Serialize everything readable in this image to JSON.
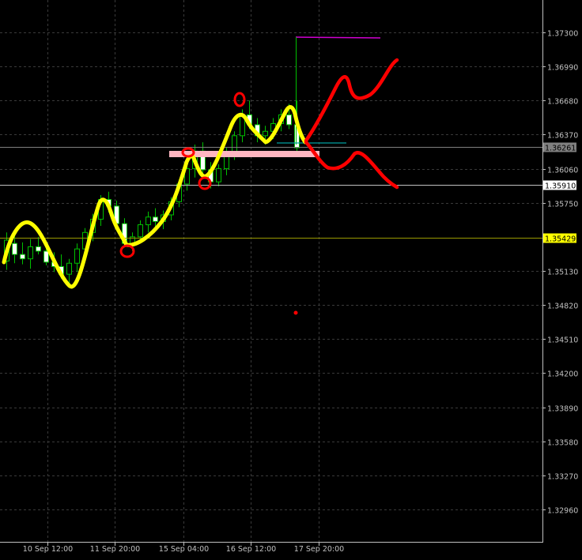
{
  "chart_data": {
    "type": "candlestick",
    "title": "",
    "xlabel": "",
    "ylabel": "",
    "grid": true,
    "ylim": [
      1.3265,
      1.3755
    ],
    "x_tick_labels": [
      "10 Sep 12:00",
      "11 Sep 20:00",
      "15 Sep 04:00",
      "16 Sep 12:00",
      "17 Sep 20:00"
    ],
    "y_tick_labels": [
      "1.37300",
      "1.36990",
      "1.36680",
      "1.36370",
      "1.36060",
      "1.35750",
      "1.35130",
      "1.34820",
      "1.34510",
      "1.34200",
      "1.33890",
      "1.33580",
      "1.33270",
      "1.32960"
    ],
    "y_ticks": [
      1.373,
      1.3699,
      1.3668,
      1.3637,
      1.3606,
      1.3575,
      1.3513,
      1.3482,
      1.3451,
      1.342,
      1.3389,
      1.3358,
      1.3327,
      1.3296
    ],
    "price_labels": [
      {
        "value": 1.36261,
        "text": "1.36261",
        "bg": "#808080",
        "fg": "#000000",
        "line": "#808080"
      },
      {
        "value": 1.3591,
        "text": "1.35910",
        "bg": "#ffffff",
        "fg": "#000000",
        "line": "#c0c0c0"
      },
      {
        "value": 1.35429,
        "text": "1.35429",
        "bg": "#ffff00",
        "fg": "#000000",
        "line": "#9a9a00"
      }
    ],
    "candles": [
      {
        "o": 1.3522,
        "h": 1.3548,
        "l": 1.3514,
        "c": 1.3541
      },
      {
        "o": 1.3538,
        "h": 1.3546,
        "l": 1.352,
        "c": 1.3528
      },
      {
        "o": 1.3528,
        "h": 1.3539,
        "l": 1.3519,
        "c": 1.3524
      },
      {
        "o": 1.3524,
        "h": 1.3542,
        "l": 1.3515,
        "c": 1.3535
      },
      {
        "o": 1.3535,
        "h": 1.3544,
        "l": 1.3528,
        "c": 1.3531
      },
      {
        "o": 1.3531,
        "h": 1.3538,
        "l": 1.3518,
        "c": 1.3521
      },
      {
        "o": 1.3521,
        "h": 1.353,
        "l": 1.3512,
        "c": 1.3517
      },
      {
        "o": 1.3517,
        "h": 1.3528,
        "l": 1.3506,
        "c": 1.351
      },
      {
        "o": 1.351,
        "h": 1.3524,
        "l": 1.3498,
        "c": 1.352
      },
      {
        "o": 1.352,
        "h": 1.3538,
        "l": 1.3512,
        "c": 1.3533
      },
      {
        "o": 1.3533,
        "h": 1.3552,
        "l": 1.3528,
        "c": 1.3548
      },
      {
        "o": 1.3548,
        "h": 1.3565,
        "l": 1.354,
        "c": 1.356
      },
      {
        "o": 1.356,
        "h": 1.3582,
        "l": 1.3554,
        "c": 1.3578
      },
      {
        "o": 1.3578,
        "h": 1.3585,
        "l": 1.3566,
        "c": 1.3572
      },
      {
        "o": 1.3572,
        "h": 1.3577,
        "l": 1.3552,
        "c": 1.3556
      },
      {
        "o": 1.3556,
        "h": 1.3561,
        "l": 1.3535,
        "c": 1.3538
      },
      {
        "o": 1.3538,
        "h": 1.3548,
        "l": 1.3531,
        "c": 1.3544
      },
      {
        "o": 1.3544,
        "h": 1.3559,
        "l": 1.3539,
        "c": 1.3555
      },
      {
        "o": 1.3555,
        "h": 1.3567,
        "l": 1.3548,
        "c": 1.3562
      },
      {
        "o": 1.3562,
        "h": 1.357,
        "l": 1.3552,
        "c": 1.3558
      },
      {
        "o": 1.3558,
        "h": 1.3568,
        "l": 1.3551,
        "c": 1.3564
      },
      {
        "o": 1.3564,
        "h": 1.358,
        "l": 1.3559,
        "c": 1.3576
      },
      {
        "o": 1.3576,
        "h": 1.3596,
        "l": 1.3571,
        "c": 1.3592
      },
      {
        "o": 1.3592,
        "h": 1.361,
        "l": 1.3586,
        "c": 1.3606
      },
      {
        "o": 1.3606,
        "h": 1.3628,
        "l": 1.3598,
        "c": 1.3622
      },
      {
        "o": 1.3622,
        "h": 1.363,
        "l": 1.36,
        "c": 1.3605
      },
      {
        "o": 1.3605,
        "h": 1.3612,
        "l": 1.3588,
        "c": 1.3594
      },
      {
        "o": 1.3594,
        "h": 1.361,
        "l": 1.359,
        "c": 1.3606
      },
      {
        "o": 1.3606,
        "h": 1.3625,
        "l": 1.36,
        "c": 1.362
      },
      {
        "o": 1.362,
        "h": 1.364,
        "l": 1.3614,
        "c": 1.3636
      },
      {
        "o": 1.3636,
        "h": 1.366,
        "l": 1.363,
        "c": 1.3655
      },
      {
        "o": 1.3655,
        "h": 1.3668,
        "l": 1.3642,
        "c": 1.3646
      },
      {
        "o": 1.3646,
        "h": 1.3652,
        "l": 1.363,
        "c": 1.3636
      },
      {
        "o": 1.3636,
        "h": 1.3645,
        "l": 1.3628,
        "c": 1.364
      },
      {
        "o": 1.364,
        "h": 1.3652,
        "l": 1.3633,
        "c": 1.3647
      },
      {
        "o": 1.3647,
        "h": 1.366,
        "l": 1.364,
        "c": 1.3655
      },
      {
        "o": 1.3655,
        "h": 1.3665,
        "l": 1.3642,
        "c": 1.3646
      },
      {
        "o": 1.3646,
        "h": 1.3668,
        "l": 1.362,
        "c": 1.3625
      }
    ],
    "candle_colors": {
      "up_body": "#000000",
      "down_body": "#ffffff",
      "outline": "#00c000"
    },
    "annotations": {
      "yellow_path_color": "#ffff00",
      "red_color": "#ff0000",
      "zone_color": "#ffb6c1",
      "magenta_color": "#d000d0",
      "cyan_color": "#00a0a0"
    }
  }
}
